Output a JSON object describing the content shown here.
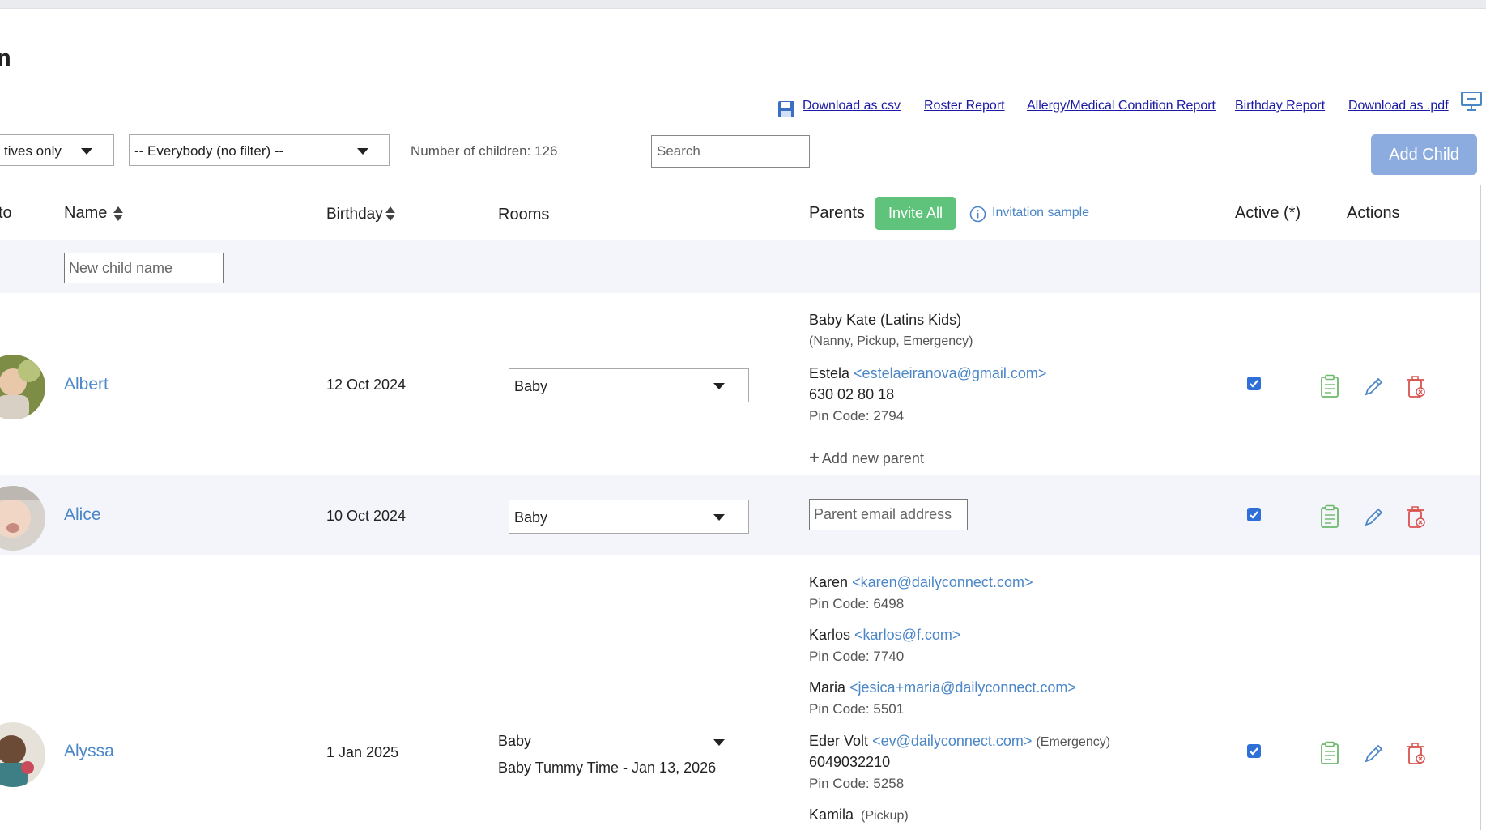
{
  "page": {
    "title": "n"
  },
  "links": {
    "download_csv": "Download as csv",
    "roster_report": "Roster Report",
    "allergy_report": "Allergy/Medical Condition Report",
    "birthday_report": "Birthday Report",
    "download_pdf": "Download as .pdf"
  },
  "filters": {
    "status_value": "tives only",
    "group_value": "-- Everybody (no filter) --",
    "count_label": "Number of children: 126",
    "search_placeholder": "Search",
    "add_child": "Add Child"
  },
  "table": {
    "headers": {
      "photo": "to",
      "name": "Name",
      "birthday": "Birthday",
      "rooms": "Rooms",
      "parents": "Parents",
      "invite_all": "Invite All",
      "invitation_sample": "Invitation sample",
      "active": "Active (*)",
      "actions": "Actions"
    },
    "new_child_placeholder": "New child name",
    "parent_email_placeholder": "Parent email address",
    "add_new_parent": "Add new parent",
    "rows": [
      {
        "name": "Albert",
        "birthday": "12 Oct 2024",
        "room": "Baby",
        "parents": [
          {
            "name": "Baby Kate (Latins Kids)",
            "roles": "(Nanny, Pickup, Emergency)"
          },
          {
            "name": "Estela",
            "email": "<estelaeiranova@gmail.com>",
            "phone": "630 02 80 18",
            "pin": "Pin Code: 2794"
          }
        ],
        "active": true
      },
      {
        "name": "Alice",
        "birthday": "10 Oct 2024",
        "room": "Baby",
        "active": true
      },
      {
        "name": "Alyssa",
        "birthday": "1 Jan 2025",
        "room": "Baby",
        "room_extra": "Baby Tummy Time - Jan 13, 2026",
        "parents": [
          {
            "name": "Karen",
            "email": "<karen@dailyconnect.com>",
            "pin": "Pin Code: 6498"
          },
          {
            "name": "Karlos",
            "email": "<karlos@f.com>",
            "pin": "Pin Code: 7740"
          },
          {
            "name": "Maria",
            "email": "<jesica+maria@dailyconnect.com>",
            "pin": "Pin Code: 5501"
          },
          {
            "name": "Eder Volt",
            "email": "<ev@dailyconnect.com>",
            "note": "(Emergency)",
            "phone": "6049032210",
            "pin": "Pin Code: 5258"
          },
          {
            "name": "Kamila",
            "note": "(Pickup)"
          }
        ],
        "active": true
      }
    ]
  },
  "colors": {
    "accent_blue": "#4a86c8",
    "invite_green": "#5fc37b",
    "add_child_blue": "#8cacdf",
    "delete_red": "#d9534f",
    "clipboard_green": "#6cb86c"
  }
}
